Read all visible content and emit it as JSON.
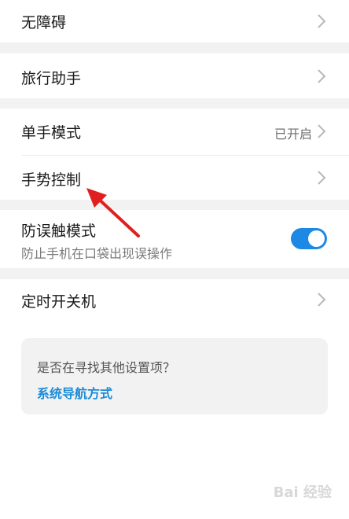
{
  "settings": {
    "accessibility": {
      "label": "无障碍"
    },
    "travel_assistant": {
      "label": "旅行助手"
    },
    "one_hand_mode": {
      "label": "单手模式",
      "value": "已开启"
    },
    "gesture_control": {
      "label": "手势控制"
    },
    "accidental_touch": {
      "label": "防误触模式",
      "description": "防止手机在口袋出现误操作",
      "enabled": true
    },
    "scheduled_power": {
      "label": "定时开关机"
    }
  },
  "help_card": {
    "question": "是否在寻找其他设置项？",
    "link": "系统导航方式"
  },
  "watermark": {
    "text": "Bai 经验"
  },
  "colors": {
    "accent": "#1e88e5",
    "link": "#1a8cd8",
    "annotation_arrow": "#e02020",
    "section_gap": "#f2f2f2"
  },
  "icons": {
    "chevron": "chevron-right-icon",
    "annotation": "red-arrow-icon"
  }
}
